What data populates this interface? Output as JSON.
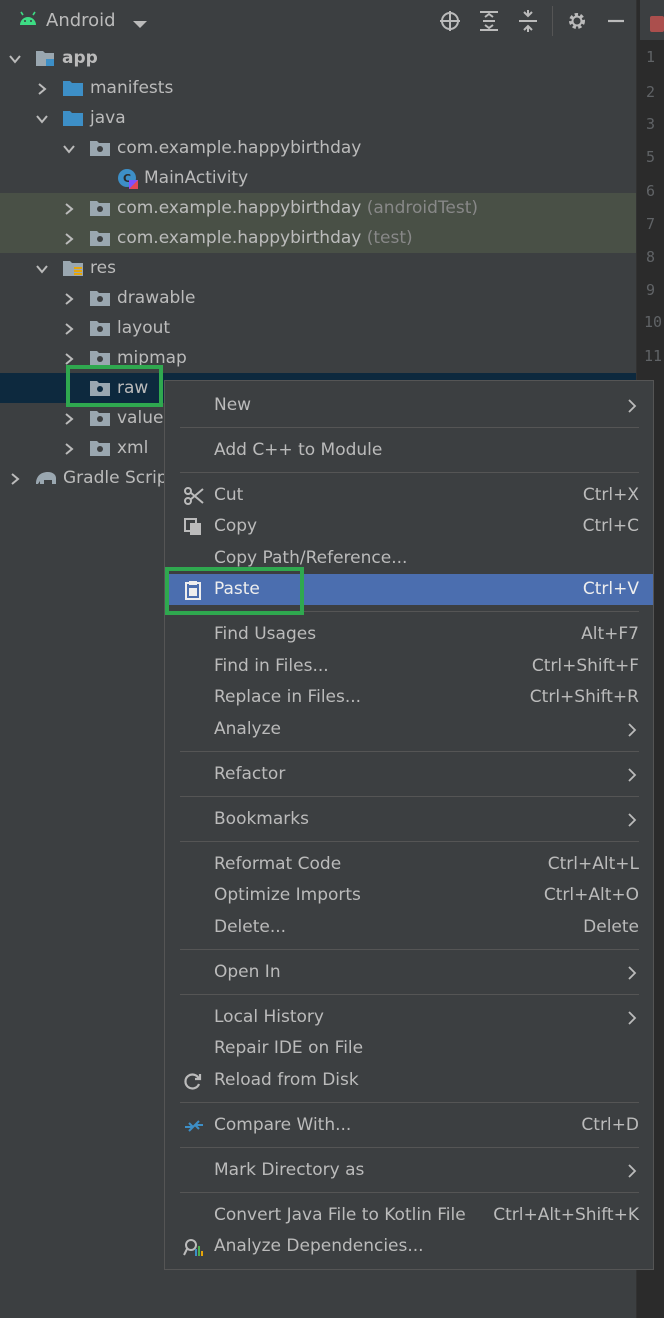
{
  "toolbar": {
    "title": "Android"
  },
  "gutter": {
    "lines": [
      "1",
      "2",
      "3",
      "5",
      "6",
      "7",
      "8",
      "9",
      "10",
      "11"
    ]
  },
  "tree": {
    "app": "app",
    "manifests": "manifests",
    "java": "java",
    "pkg_main": "com.example.happybirthday",
    "main_activity": "MainActivity",
    "pkg_android_test": "com.example.happybirthday",
    "pkg_android_test_suffix": "(androidTest)",
    "pkg_test": "com.example.happybirthday",
    "pkg_test_suffix": "(test)",
    "res": "res",
    "drawable": "drawable",
    "layout": "layout",
    "mipmap": "mipmap",
    "raw": "raw",
    "values": "values",
    "xml": "xml",
    "gradle_scripts": "Gradle Scripts"
  },
  "menu": {
    "new": {
      "label": "New"
    },
    "add_cpp": {
      "label": "Add C++ to Module"
    },
    "cut": {
      "label": "Cut",
      "shortcut": "Ctrl+X"
    },
    "copy": {
      "label": "Copy",
      "shortcut": "Ctrl+C"
    },
    "copy_path": {
      "label": "Copy Path/Reference..."
    },
    "paste": {
      "label": "Paste",
      "shortcut": "Ctrl+V"
    },
    "find_usages": {
      "label": "Find Usages",
      "shortcut": "Alt+F7"
    },
    "find_in_files": {
      "label": "Find in Files...",
      "shortcut": "Ctrl+Shift+F"
    },
    "replace_in_files": {
      "label": "Replace in Files...",
      "shortcut": "Ctrl+Shift+R"
    },
    "analyze": {
      "label": "Analyze"
    },
    "refactor": {
      "label": "Refactor"
    },
    "bookmarks": {
      "label": "Bookmarks"
    },
    "reformat": {
      "label": "Reformat Code",
      "shortcut": "Ctrl+Alt+L"
    },
    "optimize": {
      "label": "Optimize Imports",
      "shortcut": "Ctrl+Alt+O"
    },
    "delete": {
      "label": "Delete...",
      "shortcut": "Delete"
    },
    "open_in": {
      "label": "Open In"
    },
    "local_history": {
      "label": "Local History"
    },
    "repair_ide": {
      "label": "Repair IDE on File"
    },
    "reload": {
      "label": "Reload from Disk"
    },
    "compare": {
      "label": "Compare With...",
      "shortcut": "Ctrl+D"
    },
    "mark_dir": {
      "label": "Mark Directory as"
    },
    "convert": {
      "label": "Convert Java File to Kotlin File",
      "shortcut": "Ctrl+Alt+Shift+K"
    },
    "analyze_deps": {
      "label": "Analyze Dependencies..."
    }
  },
  "colors": {
    "accent": "#4b6eaf",
    "highlight_box": "#2fa84f",
    "android_green": "#3ddc84",
    "folder_blue": "#3d8fc7"
  }
}
